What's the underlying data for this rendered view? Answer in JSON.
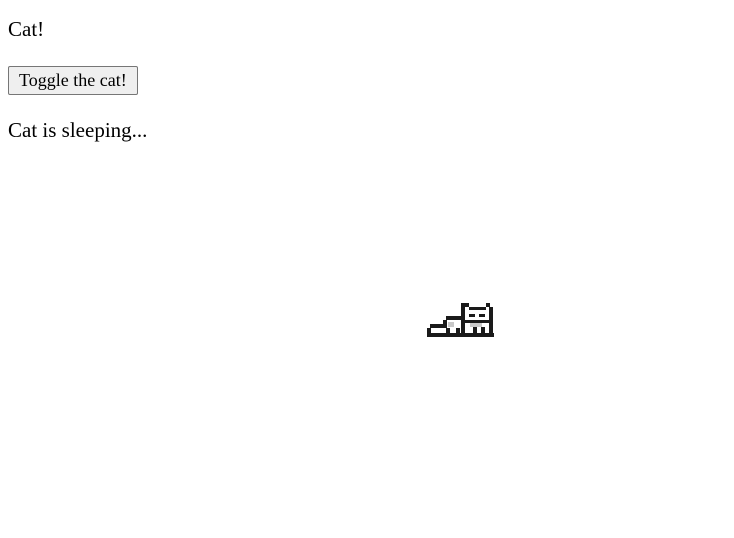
{
  "page": {
    "heading": "Cat!",
    "toggle_button_label": "Toggle the cat!",
    "status_text": "Cat is sleeping..."
  },
  "cat": {
    "state": "sleeping",
    "colors": {
      "outline": "#1a1a1a",
      "fur": "#ffffff",
      "shade": "#c8c8c8"
    }
  }
}
